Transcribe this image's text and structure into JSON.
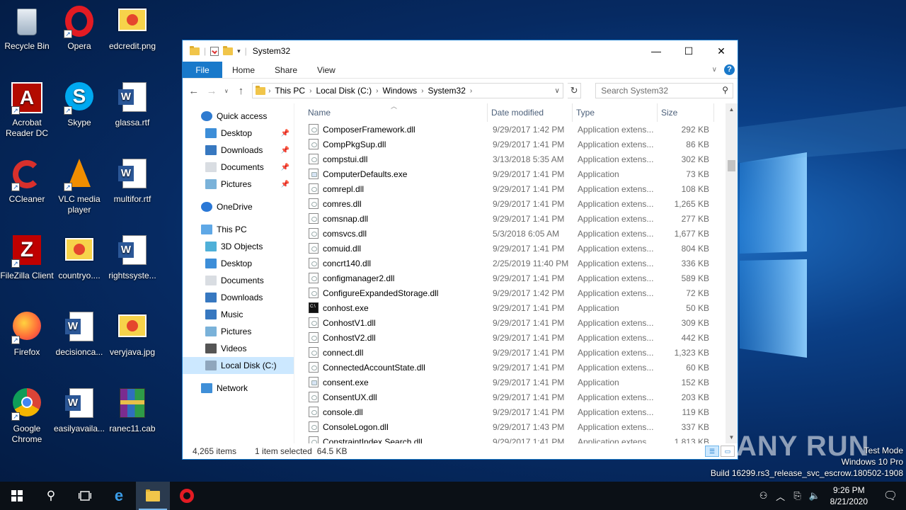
{
  "desktop": {
    "icons": [
      {
        "label": "Recycle Bin",
        "icon": "recycle-bin-icon"
      },
      {
        "label": "Opera",
        "icon": "opera-icon"
      },
      {
        "label": "edcredit.png",
        "icon": "image-file-icon"
      },
      {
        "label": "Acrobat Reader DC",
        "icon": "acrobat-icon"
      },
      {
        "label": "Skype",
        "icon": "skype-icon"
      },
      {
        "label": "glassa.rtf",
        "icon": "word-doc-icon"
      },
      {
        "label": "CCleaner",
        "icon": "ccleaner-icon"
      },
      {
        "label": "VLC media player",
        "icon": "vlc-icon"
      },
      {
        "label": "multifor.rtf",
        "icon": "word-doc-icon"
      },
      {
        "label": "FileZilla Client",
        "icon": "filezilla-icon"
      },
      {
        "label": "countryo....",
        "icon": "image-file-icon"
      },
      {
        "label": "rightssyste...",
        "icon": "word-doc-icon"
      },
      {
        "label": "Firefox",
        "icon": "firefox-icon"
      },
      {
        "label": "decisionca...",
        "icon": "word-doc-icon"
      },
      {
        "label": "veryjava.jpg",
        "icon": "image-file-icon"
      },
      {
        "label": "Google Chrome",
        "icon": "chrome-icon"
      },
      {
        "label": "easilyavaila...",
        "icon": "word-doc-icon"
      },
      {
        "label": "ranec11.cab",
        "icon": "archive-icon"
      }
    ]
  },
  "window": {
    "title": "System32",
    "controls": {
      "minimize": "—",
      "maximize": "☐",
      "close": "✕"
    }
  },
  "ribbon": {
    "file": "File",
    "tabs": [
      "Home",
      "Share",
      "View"
    ],
    "help": "?"
  },
  "address": {
    "crumbs": [
      "This PC",
      "Local Disk (C:)",
      "Windows",
      "System32"
    ],
    "search_placeholder": "Search System32"
  },
  "nav": {
    "quick_access": "Quick access",
    "quick_items": [
      "Desktop",
      "Downloads",
      "Documents",
      "Pictures"
    ],
    "onedrive": "OneDrive",
    "this_pc": "This PC",
    "pc_items": [
      "3D Objects",
      "Desktop",
      "Documents",
      "Downloads",
      "Music",
      "Pictures",
      "Videos",
      "Local Disk (C:)"
    ],
    "network": "Network"
  },
  "columns": {
    "name": "Name",
    "date": "Date modified",
    "type": "Type",
    "size": "Size"
  },
  "files": [
    {
      "name": "ComposerFramework.dll",
      "date": "9/29/2017 1:42 PM",
      "type": "Application extens...",
      "size": "292 KB",
      "kind": "dll"
    },
    {
      "name": "CompPkgSup.dll",
      "date": "9/29/2017 1:41 PM",
      "type": "Application extens...",
      "size": "86 KB",
      "kind": "dll"
    },
    {
      "name": "compstui.dll",
      "date": "3/13/2018 5:35 AM",
      "type": "Application extens...",
      "size": "302 KB",
      "kind": "dll"
    },
    {
      "name": "ComputerDefaults.exe",
      "date": "9/29/2017 1:41 PM",
      "type": "Application",
      "size": "73 KB",
      "kind": "exe"
    },
    {
      "name": "comrepl.dll",
      "date": "9/29/2017 1:41 PM",
      "type": "Application extens...",
      "size": "108 KB",
      "kind": "dll"
    },
    {
      "name": "comres.dll",
      "date": "9/29/2017 1:41 PM",
      "type": "Application extens...",
      "size": "1,265 KB",
      "kind": "dll"
    },
    {
      "name": "comsnap.dll",
      "date": "9/29/2017 1:41 PM",
      "type": "Application extens...",
      "size": "277 KB",
      "kind": "dll"
    },
    {
      "name": "comsvcs.dll",
      "date": "5/3/2018 6:05 AM",
      "type": "Application extens...",
      "size": "1,677 KB",
      "kind": "dll"
    },
    {
      "name": "comuid.dll",
      "date": "9/29/2017 1:41 PM",
      "type": "Application extens...",
      "size": "804 KB",
      "kind": "dll"
    },
    {
      "name": "concrt140.dll",
      "date": "2/25/2019 11:40 PM",
      "type": "Application extens...",
      "size": "336 KB",
      "kind": "dll"
    },
    {
      "name": "configmanager2.dll",
      "date": "9/29/2017 1:41 PM",
      "type": "Application extens...",
      "size": "589 KB",
      "kind": "dll"
    },
    {
      "name": "ConfigureExpandedStorage.dll",
      "date": "9/29/2017 1:42 PM",
      "type": "Application extens...",
      "size": "72 KB",
      "kind": "dll"
    },
    {
      "name": "conhost.exe",
      "date": "9/29/2017 1:41 PM",
      "type": "Application",
      "size": "50 KB",
      "kind": "cmd"
    },
    {
      "name": "ConhostV1.dll",
      "date": "9/29/2017 1:41 PM",
      "type": "Application extens...",
      "size": "309 KB",
      "kind": "dll"
    },
    {
      "name": "ConhostV2.dll",
      "date": "9/29/2017 1:41 PM",
      "type": "Application extens...",
      "size": "442 KB",
      "kind": "dll"
    },
    {
      "name": "connect.dll",
      "date": "9/29/2017 1:41 PM",
      "type": "Application extens...",
      "size": "1,323 KB",
      "kind": "dll"
    },
    {
      "name": "ConnectedAccountState.dll",
      "date": "9/29/2017 1:41 PM",
      "type": "Application extens...",
      "size": "60 KB",
      "kind": "dll"
    },
    {
      "name": "consent.exe",
      "date": "9/29/2017 1:41 PM",
      "type": "Application",
      "size": "152 KB",
      "kind": "exe"
    },
    {
      "name": "ConsentUX.dll",
      "date": "9/29/2017 1:41 PM",
      "type": "Application extens...",
      "size": "203 KB",
      "kind": "dll"
    },
    {
      "name": "console.dll",
      "date": "9/29/2017 1:41 PM",
      "type": "Application extens...",
      "size": "119 KB",
      "kind": "dll"
    },
    {
      "name": "ConsoleLogon.dll",
      "date": "9/29/2017 1:43 PM",
      "type": "Application extens...",
      "size": "337 KB",
      "kind": "dll"
    },
    {
      "name": "ConstraintIndex.Search.dll",
      "date": "9/29/2017 1:41 PM",
      "type": "Application extens...",
      "size": "1,813 KB",
      "kind": "dll"
    }
  ],
  "status": {
    "count": "4,265 items",
    "selected": "1 item selected",
    "size": "64.5 KB"
  },
  "watermark": {
    "logo": "ANY RUN",
    "line1": "Test Mode",
    "line2": "Windows 10 Pro",
    "line3": "Build 16299.rs3_release_svc_escrow.180502-1908"
  },
  "taskbar": {
    "time": "9:26 PM",
    "date": "8/21/2020"
  }
}
